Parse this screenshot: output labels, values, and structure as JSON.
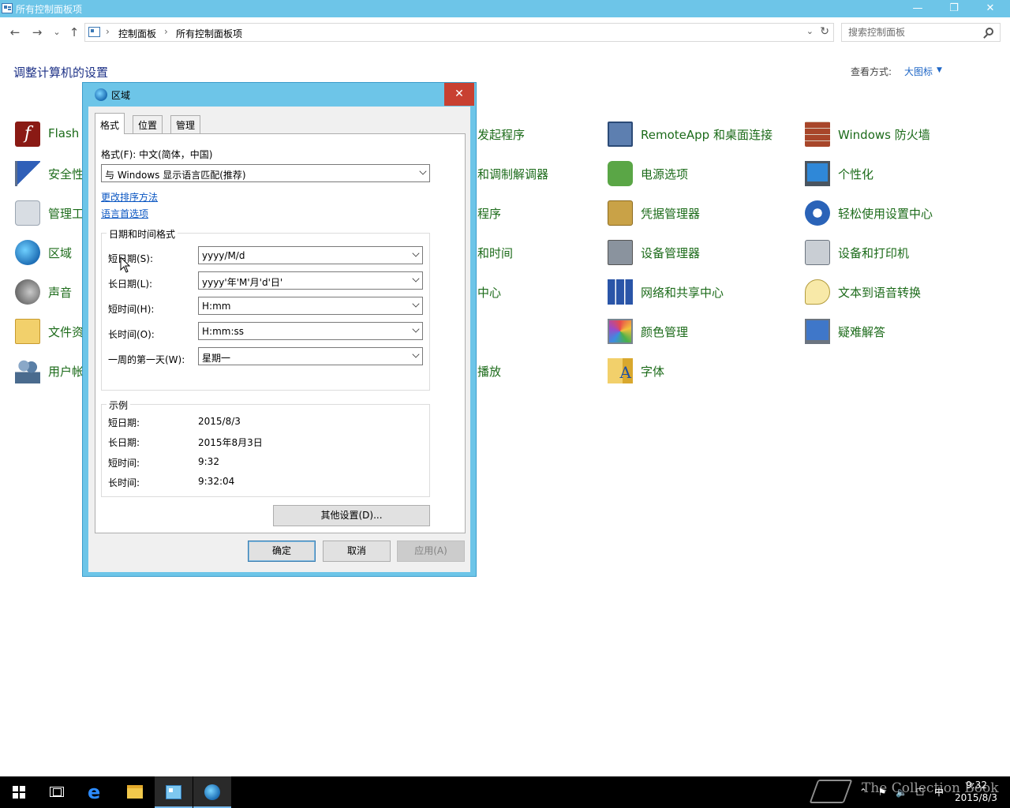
{
  "window": {
    "title": "所有控制面板项",
    "minimize": "—",
    "restore": "❐",
    "close": "✕"
  },
  "address": {
    "back": "←",
    "forward": "→",
    "recent": "⌄",
    "up": "↑",
    "sep": "›",
    "crumbs": [
      "控制面板",
      "所有控制面板项"
    ],
    "dropdown": "⌄",
    "refresh": "↻",
    "search_placeholder": "搜索控制面板"
  },
  "main": {
    "heading": "调整计算机的设置",
    "view_by_label": "查看方式:",
    "view_by_value": "大图标",
    "view_by_arrow": "▼",
    "items": [
      {
        "label": "Flash",
        "icon": "flash-icon"
      },
      {
        "label": "安全性",
        "icon": "flag-icon"
      },
      {
        "label": "管理工",
        "icon": "tools-icon"
      },
      {
        "label": "区域",
        "icon": "globe-icon"
      },
      {
        "label": "声音",
        "icon": "speaker-icon"
      },
      {
        "label": "文件资",
        "icon": "folder-icon"
      },
      {
        "label": "用户帐",
        "icon": "users-icon"
      },
      {
        "label": "发起程序"
      },
      {
        "label": "和调制解调器"
      },
      {
        "label": "程序"
      },
      {
        "label": "和时间"
      },
      {
        "label": "中心"
      },
      {
        "label": "播放"
      },
      {
        "label": "RemoteApp 和桌面连接",
        "icon": "remote-desktop-icon"
      },
      {
        "label": "电源选项",
        "icon": "power-icon"
      },
      {
        "label": "凭据管理器",
        "icon": "vault-icon"
      },
      {
        "label": "设备管理器",
        "icon": "device-manager-icon"
      },
      {
        "label": "网络和共享中心",
        "icon": "network-icon"
      },
      {
        "label": "颜色管理",
        "icon": "color-icon"
      },
      {
        "label": "字体",
        "icon": "font-icon"
      },
      {
        "label": "Windows 防火墙",
        "icon": "firewall-icon"
      },
      {
        "label": "个性化",
        "icon": "personalization-icon"
      },
      {
        "label": "轻松使用设置中心",
        "icon": "ease-of-access-icon"
      },
      {
        "label": "设备和打印机",
        "icon": "printer-icon"
      },
      {
        "label": "文本到语音转换",
        "icon": "speech-icon"
      },
      {
        "label": "疑难解答",
        "icon": "troubleshoot-icon"
      }
    ]
  },
  "dialog": {
    "title": "区域",
    "close": "✕",
    "tabs": [
      "格式",
      "位置",
      "管理"
    ],
    "format_label": "格式(F): 中文(简体，中国)",
    "format_value": "与 Windows 显示语言匹配(推荐)",
    "link_sort": "更改排序方法",
    "link_lang": "语言首选项",
    "datetime_group": "日期和时间格式",
    "fields": [
      {
        "label": "短日期(S):",
        "value": "yyyy/M/d"
      },
      {
        "label": "长日期(L):",
        "value": "yyyy'年'M'月'd'日'"
      },
      {
        "label": "短时间(H):",
        "value": "H:mm"
      },
      {
        "label": "长时间(O):",
        "value": "H:mm:ss"
      },
      {
        "label": "一周的第一天(W):",
        "value": "星期一"
      }
    ],
    "example_group": "示例",
    "examples": [
      {
        "label": "短日期:",
        "value": "2015/8/3"
      },
      {
        "label": "长日期:",
        "value": "2015年8月3日"
      },
      {
        "label": "短时间:",
        "value": "9:32"
      },
      {
        "label": "长时间:",
        "value": "9:32:04"
      }
    ],
    "other_settings": "其他设置(D)...",
    "ok": "确定",
    "cancel": "取消",
    "apply": "应用(A)"
  },
  "taskbar": {
    "tray": [
      "⌃",
      "⚑",
      "🔈",
      "☐",
      "中"
    ],
    "time": "9:32",
    "date": "2015/8/3",
    "watermark": "The Collection Book"
  }
}
